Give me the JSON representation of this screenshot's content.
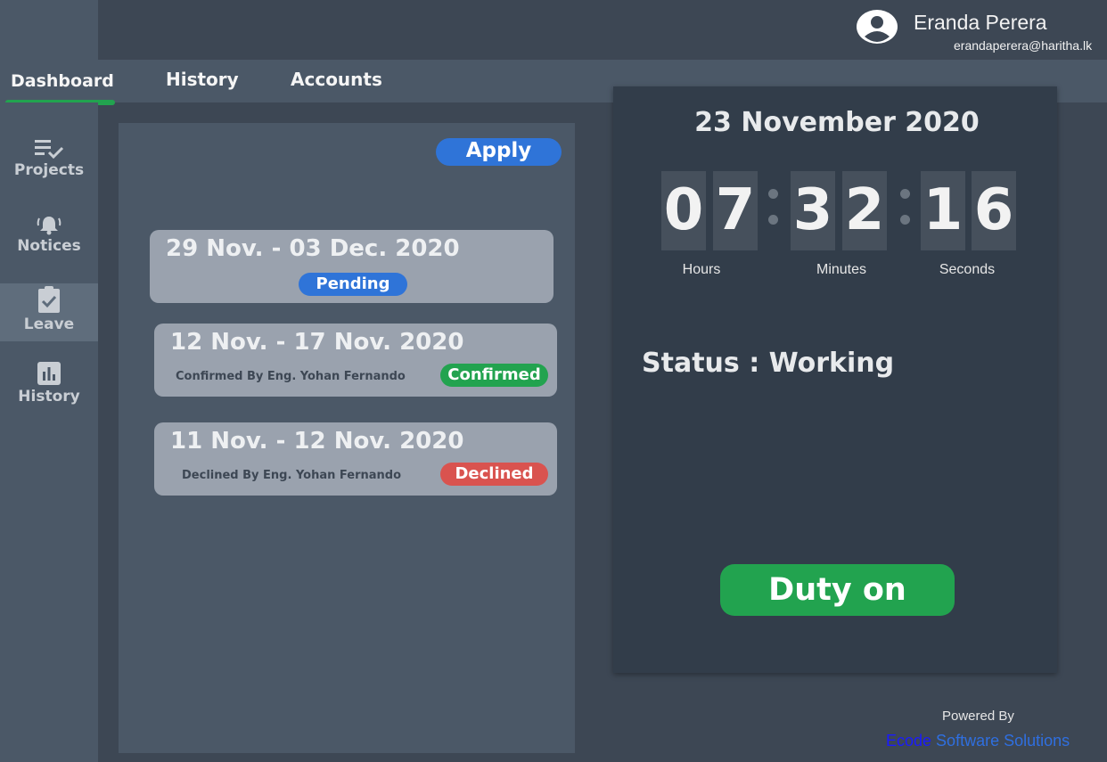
{
  "user": {
    "name": "Eranda Perera",
    "email": "erandaperera@haritha.lk",
    "avatar_icon": "account-circle-icon"
  },
  "nav": {
    "tabs": [
      {
        "label": "Dashboard",
        "active": true
      },
      {
        "label": "History",
        "active": false
      },
      {
        "label": "Accounts",
        "active": false
      }
    ]
  },
  "sidebar": {
    "items": [
      {
        "label": "Projects",
        "icon": "list-check-icon",
        "active": false
      },
      {
        "label": "Notices",
        "icon": "bell-alert-icon",
        "active": false
      },
      {
        "label": "Leave",
        "icon": "clipboard-check-icon",
        "active": true
      },
      {
        "label": "History",
        "icon": "bar-chart-icon",
        "active": false
      }
    ]
  },
  "leave": {
    "apply_label": "Apply",
    "requests": [
      {
        "dates": "29 Nov. - 03 Dec. 2020",
        "by": "",
        "status": "Pending",
        "color": "#2f74d8"
      },
      {
        "dates": "12 Nov. - 17 Nov. 2020",
        "by": "Confirmed By Eng. Yohan Fernando",
        "status": "Confirmed",
        "color": "#22a34f"
      },
      {
        "dates": "11 Nov. - 12 Nov. 2020",
        "by": "Declined By Eng. Yohan Fernando",
        "status": "Declined",
        "color": "#d9534f"
      }
    ]
  },
  "clock": {
    "date": "23 November 2020",
    "hours": [
      "0",
      "7"
    ],
    "minutes": [
      "3",
      "2"
    ],
    "seconds": [
      "1",
      "6"
    ],
    "labels": {
      "hours": "Hours",
      "minutes": "Minutes",
      "seconds": "Seconds"
    }
  },
  "status": {
    "text": "Status : Working"
  },
  "duty_button": "Duty on",
  "footer": {
    "powered_by": "Powered By",
    "company_part1": "Ecode",
    "company_part2": " Software Solutions",
    "color1": "#1a1aff",
    "color2": "#2f6fe0"
  }
}
